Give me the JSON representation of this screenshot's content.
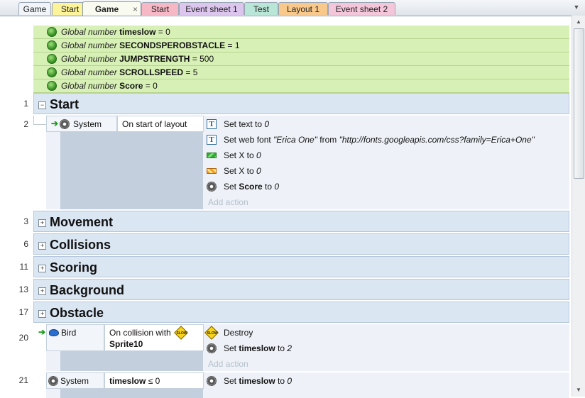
{
  "tabs": [
    {
      "label": "Game",
      "color": "#f1f4f8",
      "active": false
    },
    {
      "label": "Start",
      "color": "#fdf39a",
      "active": false
    },
    {
      "label": "Game",
      "color": "#f9fbf0",
      "active": true
    },
    {
      "label": "Start",
      "color": "#f6b8c4",
      "active": false
    },
    {
      "label": "Event sheet 1",
      "color": "#dcc6ee",
      "active": false
    },
    {
      "label": "Test",
      "color": "#b9e6d6",
      "active": false
    },
    {
      "label": "Layout 1",
      "color": "#f9c98b",
      "active": false
    },
    {
      "label": "Event sheet 2",
      "color": "#f3c6d9",
      "active": false
    }
  ],
  "tab_close_glyph": "×",
  "dropdown_glyph": "▼",
  "globals": [
    {
      "keyword": "Global number",
      "name": "timeslow",
      "value": "= 0"
    },
    {
      "keyword": "Global number",
      "name": "SECONDSPEROBSTACLE",
      "value": "= 1"
    },
    {
      "keyword": "Global number",
      "name": "JUMPSTRENGTH",
      "value": "= 500"
    },
    {
      "keyword": "Global number",
      "name": "SCROLLSPEED",
      "value": "= 5"
    },
    {
      "keyword": "Global number",
      "name": "Score",
      "value": "= 0"
    }
  ],
  "groups": {
    "start": {
      "row": "1",
      "title": "Start",
      "expanded": true
    },
    "movement": {
      "row": "3",
      "title": "Movement"
    },
    "collisions": {
      "row": "6",
      "title": "Collisions"
    },
    "scoring": {
      "row": "11",
      "title": "Scoring"
    },
    "background": {
      "row": "13",
      "title": "Background"
    },
    "obstacle": {
      "row": "17",
      "title": "Obstacle"
    }
  },
  "toggle": {
    "expanded": "−",
    "collapsed": "+"
  },
  "event2": {
    "row": "2",
    "object": "System",
    "condition": "On start of layout",
    "actions": [
      {
        "icon": "text-icon",
        "pre": "Set text to ",
        "arg": "0",
        "post": ""
      },
      {
        "icon": "text-icon",
        "pre": "Set web font ",
        "arg": "\"Erica One\"",
        "mid": " from ",
        "arg2": "\"http://fonts.googleapis.com/css?family=Erica+One\""
      },
      {
        "icon": "tiled-green-icon",
        "pre": "Set X to ",
        "arg": "0"
      },
      {
        "icon": "tiled-orange-icon",
        "pre": "Set X to ",
        "arg": "0"
      },
      {
        "icon": "gear-icon",
        "pre": "Set ",
        "bold": "Score",
        "post": " to ",
        "arg": "0"
      }
    ],
    "add_action": "Add action"
  },
  "event20": {
    "row": "20",
    "object": "Bird",
    "condition_line1": "On collision with",
    "condition_line2": "Sprite10",
    "actions": [
      {
        "icon": "slow-sign-icon",
        "label": "Destroy"
      },
      {
        "icon": "gear-icon",
        "pre": "Set ",
        "bold": "timeslow",
        "post": " to ",
        "arg": "2"
      }
    ],
    "add_action": "Add action"
  },
  "event21": {
    "row": "21",
    "object": "System",
    "condition_name": "timeslow",
    "condition_op": " ≤ 0",
    "actions": [
      {
        "icon": "gear-icon",
        "pre": "Set ",
        "bold": "timeslow",
        "post": " to ",
        "arg": "0"
      }
    ]
  },
  "slow_sign_text": "SLOW",
  "text_icon_glyph": "T",
  "arrow_glyph": "➔",
  "scroll": {
    "up": "▲",
    "down": "▼"
  }
}
